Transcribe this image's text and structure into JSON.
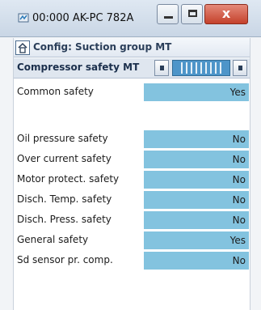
{
  "window": {
    "title": "00:000 AK-PC 782A",
    "close_glyph": "x"
  },
  "config": {
    "title": "Config: Suction group MT"
  },
  "group": {
    "title": "Compressor safety MT"
  },
  "rows": [
    {
      "label": "Common safety",
      "value": "Yes"
    },
    {
      "label": "Oil pressure safety",
      "value": "No"
    },
    {
      "label": "Over current safety",
      "value": "No"
    },
    {
      "label": "Motor protect. safety",
      "value": "No"
    },
    {
      "label": "Disch. Temp. safety",
      "value": "No"
    },
    {
      "label": "Disch. Press. safety",
      "value": "No"
    },
    {
      "label": "General safety",
      "value": "Yes"
    },
    {
      "label": "Sd sensor pr. comp.",
      "value": "No"
    }
  ],
  "colors": {
    "value_background": "#83c3df",
    "track": "#4d95c9",
    "close_button": "#c4412b"
  },
  "icons": [
    "app-icon",
    "minimize-icon",
    "maximize-icon",
    "close-icon",
    "home-icon",
    "arrow-left-icon",
    "arrow-right-icon"
  ]
}
